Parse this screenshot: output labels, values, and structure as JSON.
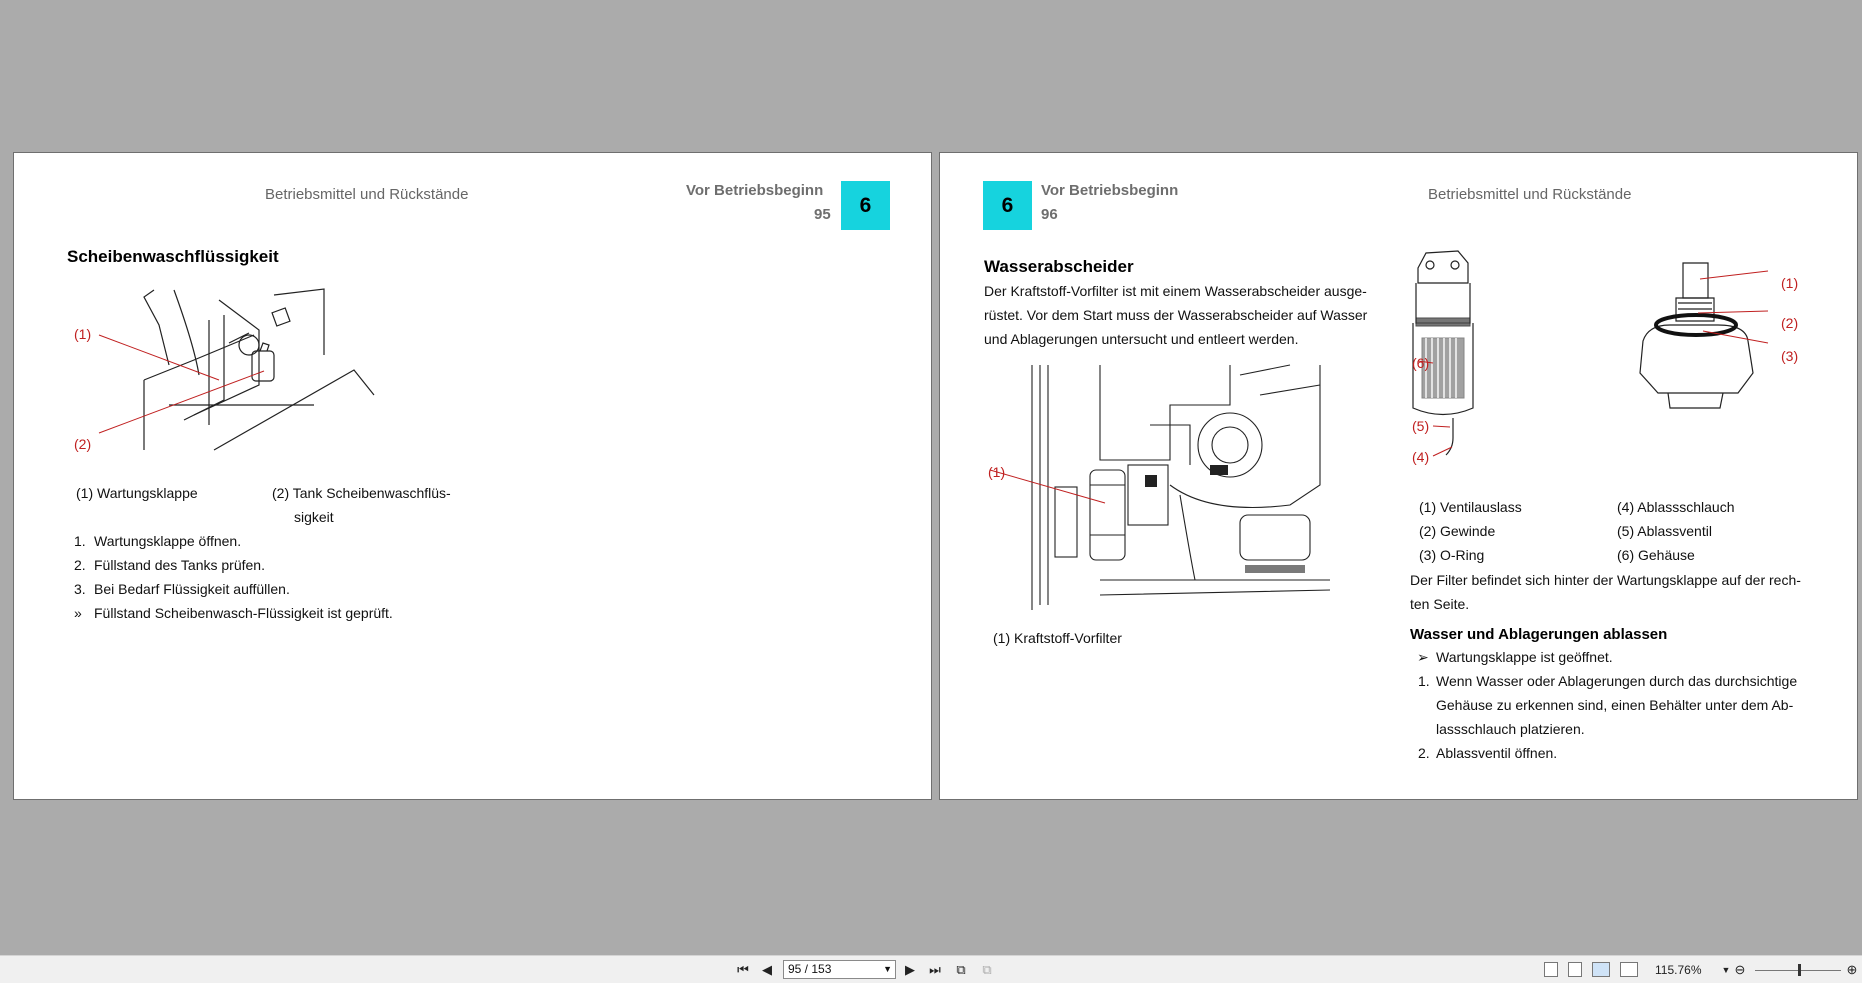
{
  "left_page": {
    "running_header": "Betriebsmittel und Rückstände",
    "chapter_title": "Vor Betriebsbeginn",
    "page_number": "95",
    "chapter_number": "6",
    "section_title": "Scheibenwaschflüssigkeit",
    "figure_callouts": [
      "(1)",
      "(2)"
    ],
    "legend": [
      "(1) Wartungsklappe",
      "(2) Tank Scheibenwaschflüs-",
      "sigkeit"
    ],
    "steps": [
      {
        "marker": "1.",
        "text": "Wartungsklappe öffnen."
      },
      {
        "marker": "2.",
        "text": "Füllstand des Tanks prüfen."
      },
      {
        "marker": "3.",
        "text": "Bei Bedarf Flüssigkeit auffüllen."
      },
      {
        "marker": "»",
        "text": "Füllstand Scheibenwasch-Flüssigkeit ist geprüft."
      }
    ]
  },
  "right_page": {
    "chapter_number": "6",
    "chapter_title": "Vor Betriebsbeginn",
    "page_number": "96",
    "running_header": "Betriebsmittel und Rückstände",
    "section_title": "Wasserabscheider",
    "intro_lines": [
      "Der Kraftstoff-Vorfilter ist mit einem Wasserabscheider ausge-",
      "rüstet. Vor dem Start muss der Wasserabscheider auf Wasser",
      "und Ablagerungen untersucht und entleert werden."
    ],
    "engine_callout": "(1)",
    "engine_caption": "(1) Kraftstoff-Vorfilter",
    "filter_callouts": [
      "(1)",
      "(2)",
      "(3)",
      "(4)",
      "(5)",
      "(6)"
    ],
    "parts_legend": [
      "(1) Ventilauslass",
      "(4) Ablassschlauch",
      "(2) Gewinde",
      "(5) Ablassventil",
      "(3) O-Ring",
      "(6) Gehäuse"
    ],
    "location_lines": [
      "Der Filter befindet sich hinter der Wartungsklappe auf der rech-",
      "ten Seite."
    ],
    "subsection_title": "Wasser und Ablagerungen ablassen",
    "precondition": {
      "marker": "➢",
      "text": "Wartungsklappe ist geöffnet."
    },
    "steps": [
      {
        "marker": "1.",
        "lines": [
          "Wenn Wasser oder Ablagerungen durch das durchsichtige",
          "Gehäuse zu erkennen sind, einen Behälter unter dem Ab-",
          "lassschlauch platzieren."
        ]
      },
      {
        "marker": "2.",
        "lines": [
          "Ablassventil öffnen."
        ]
      }
    ]
  },
  "statusbar": {
    "page_field": "95 / 153",
    "zoom": "115.76%",
    "icons": [
      "first-page-icon",
      "prev-page-icon",
      "next-page-icon",
      "last-page-icon",
      "previous-view-icon",
      "next-view-icon",
      "single-page-icon",
      "continuous-icon",
      "facing-icon",
      "continuous-facing-icon",
      "zoom-out-icon",
      "zoom-in-icon"
    ]
  },
  "colors": {
    "chapter_box": "#16d3de",
    "callout": "#c02020",
    "background": "#ababab"
  }
}
